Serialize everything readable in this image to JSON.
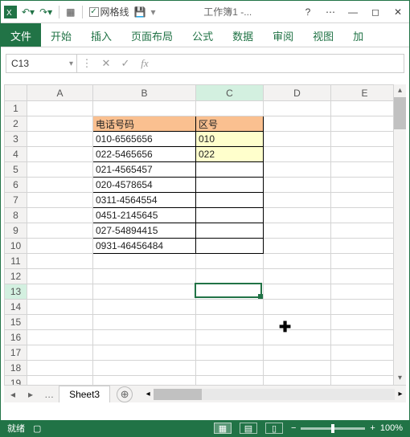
{
  "titlebar": {
    "gridlines_label": "网格线",
    "workbook_title": "工作簿1 -...",
    "help": "?",
    "overflow": "⋯"
  },
  "ribbon": {
    "file": "文件",
    "tabs": [
      "开始",
      "插入",
      "页面布局",
      "公式",
      "数据",
      "审阅",
      "视图",
      "加"
    ]
  },
  "namebox": "C13",
  "sheet": {
    "columns": [
      "A",
      "B",
      "C",
      "D",
      "E"
    ],
    "rows": 20,
    "header_B": "电话号码",
    "header_C": "区号",
    "data": [
      {
        "b": "010-6565656",
        "c": "010"
      },
      {
        "b": "022-5465656",
        "c": "022"
      },
      {
        "b": "021-4565457",
        "c": ""
      },
      {
        "b": "020-4578654",
        "c": ""
      },
      {
        "b": "0311-4564554",
        "c": ""
      },
      {
        "b": "0451-2145645",
        "c": ""
      },
      {
        "b": "027-54894415",
        "c": ""
      },
      {
        "b": "0931-46456484",
        "c": ""
      }
    ],
    "selected_cell": "C13",
    "selected_row": 13,
    "selected_col": "C"
  },
  "sheettab": {
    "active": "Sheet3"
  },
  "status": {
    "ready": "就绪",
    "zoom": "100%"
  },
  "chart_data": {
    "type": "table",
    "columns": [
      "电话号码",
      "区号"
    ],
    "rows": [
      [
        "010-6565656",
        "010"
      ],
      [
        "022-5465656",
        "022"
      ],
      [
        "021-4565457",
        ""
      ],
      [
        "020-4578654",
        ""
      ],
      [
        "0311-4564554",
        ""
      ],
      [
        "0451-2145645",
        ""
      ],
      [
        "027-54894415",
        ""
      ],
      [
        "0931-46456484",
        ""
      ]
    ]
  }
}
